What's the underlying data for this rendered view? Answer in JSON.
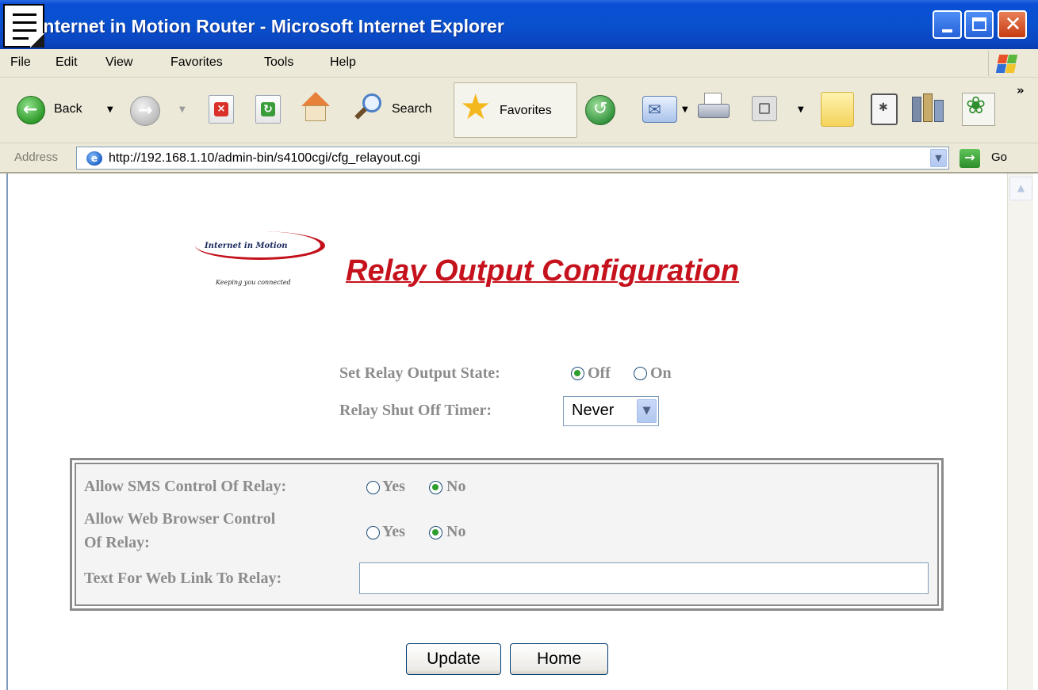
{
  "window": {
    "title": "Internet in Motion Router - Microsoft Internet Explorer"
  },
  "menu": {
    "items": [
      "File",
      "Edit",
      "View",
      "Favorites",
      "Tools",
      "Help"
    ]
  },
  "toolbar": {
    "back_label": "Back",
    "search_label": "Search",
    "favorites_label": "Favorites",
    "chevron": "»"
  },
  "address": {
    "label": "Address",
    "url": "http://192.168.1.10/admin-bin/s4100cgi/cfg_relayout.cgi",
    "go_label": "Go"
  },
  "page": {
    "logo_name": "Internet in Motion",
    "logo_tagline": "Keeping you connected",
    "heading": "Relay Output Configuration",
    "relay_state": {
      "label": "Set Relay Output State:",
      "options": [
        "Off",
        "On"
      ],
      "selected": "Off"
    },
    "shutoff_timer": {
      "label": "Relay Shut Off Timer:",
      "value": "Never"
    },
    "sms_control": {
      "label": "Allow SMS Control Of Relay:",
      "options": [
        "Yes",
        "No"
      ],
      "selected": "No"
    },
    "web_control": {
      "label_line1": "Allow Web Browser Control",
      "label_line2": "Of Relay:",
      "options": [
        "Yes",
        "No"
      ],
      "selected": "No"
    },
    "web_link_text": {
      "label": "Text For Web Link To Relay:",
      "value": ""
    },
    "buttons": {
      "update": "Update",
      "home": "Home"
    }
  },
  "colors": {
    "titlebar": "#0851cf",
    "chrome": "#ece9d8",
    "heading_red": "#c6121d",
    "label_gray": "#8c8c8c",
    "radio_selected": "#2d9d2d"
  }
}
